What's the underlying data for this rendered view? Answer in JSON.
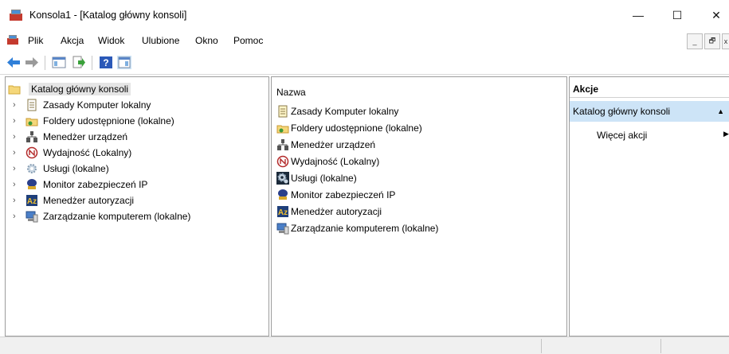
{
  "window": {
    "title": "Konsola1 - [Katalog główny konsoli]",
    "controls": {
      "minimize": "—",
      "maximize": "☐",
      "close": "✕"
    }
  },
  "menu": {
    "items": [
      "Plik",
      "Akcja",
      "Widok",
      "Ulubione",
      "Okno",
      "Pomoc"
    ],
    "mdi_controls": {
      "minimize": "_",
      "restore": "🗗",
      "close": "x"
    }
  },
  "toolbar": {
    "buttons": [
      "back-icon",
      "forward-icon",
      "show-hide-console-tree-icon",
      "export-list-icon",
      "help-icon",
      "show-hide-action-pane-icon"
    ]
  },
  "tree": {
    "root": "Katalog główny konsoli",
    "items": [
      "Zasady Komputer lokalny",
      "Foldery udostępnione (lokalne)",
      "Menedżer urządzeń",
      "Wydajność (Lokalny)",
      "Usługi (lokalne)",
      "Monitor zabezpieczeń IP",
      "Menedżer autoryzacji",
      "Zarządzanie komputerem (lokalne)"
    ]
  },
  "list": {
    "column_header": "Nazwa",
    "items": [
      "Zasady Komputer lokalny",
      "Foldery udostępnione (lokalne)",
      "Menedżer urządzeń",
      "Wydajność (Lokalny)",
      "Usługi (lokalne)",
      "Monitor zabezpieczeń IP",
      "Menedżer autoryzacji",
      "Zarządzanie komputerem (lokalne)"
    ]
  },
  "actions": {
    "title": "Akcje",
    "section": "Katalog główny konsoli",
    "more": "Więcej akcji"
  },
  "colors": {
    "selection": "#cde4f7",
    "tree_selected": "#e5e5e5",
    "back_arrow": "#2f7fd8"
  }
}
